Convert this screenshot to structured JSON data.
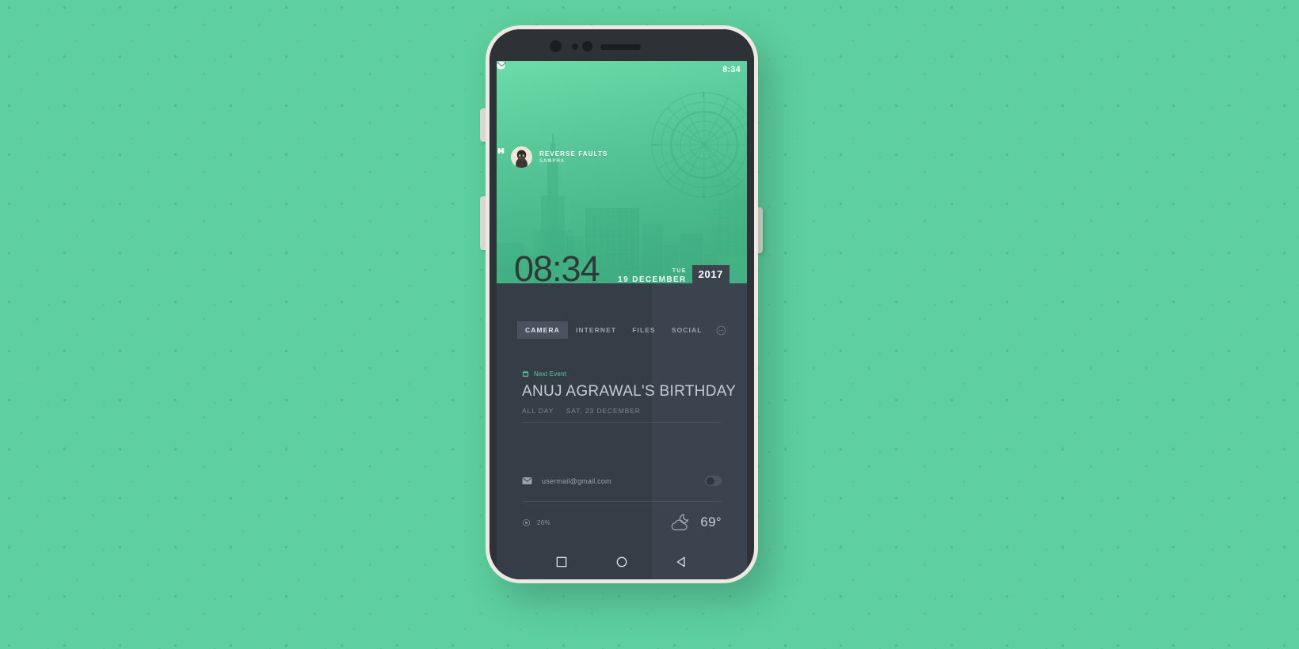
{
  "wallpaper_theme": {
    "accent_green": "#5ecf9e",
    "panel_dark": "#3b434e",
    "text_muted": "#9aa3ae"
  },
  "statusbar": {
    "left_icons": [
      "music-note-icon",
      "photo-icon",
      "play-store-icon"
    ],
    "right_icons": [
      "wifi-icon",
      "signal-icon",
      "battery-circle-icon"
    ],
    "time": "8:34",
    "expand_icon": "chevron-down-icon"
  },
  "music_widget": {
    "track_title": "REVERSE FAULTS",
    "artist": "SAMPHA",
    "album_art_icon": "album-art-avatar",
    "controls": [
      {
        "name": "previous-track-button",
        "icon": "skip-previous-icon"
      },
      {
        "name": "next-track-button",
        "icon": "skip-next-icon"
      },
      {
        "name": "pause-button",
        "icon": "pause-icon"
      }
    ]
  },
  "clock": {
    "time": "08:34",
    "day_of_week": "TUE",
    "day_month": "19 DECEMBER",
    "year": "2017"
  },
  "tabs": {
    "items": [
      {
        "label": "CAMERA",
        "active": true
      },
      {
        "label": "INTERNET",
        "active": false
      },
      {
        "label": "FILES",
        "active": false
      },
      {
        "label": "SOCIAL",
        "active": false
      }
    ],
    "more_icon": "overflow-circle-icon"
  },
  "event": {
    "icon": "calendar-icon",
    "label": "Next Event",
    "title": "ANUJ AGRAWAL'S BIRTHDAY",
    "all_day": "ALL DAY",
    "date": "SAT, 23 DECEMBER"
  },
  "mail": {
    "icon": "envelope-icon",
    "address": "usermail@gmail.com",
    "toggle_state": "off"
  },
  "weather": {
    "battery_icon": "battery-circle-icon",
    "battery_percent": "26%",
    "condition_icon": "cloudy-night-icon",
    "temperature": "69°"
  },
  "dock": {
    "items": [
      {
        "name": "app-drawer-button",
        "icon": "app-grid-icon"
      },
      {
        "name": "telegram-button",
        "icon": "paper-plane-icon"
      },
      {
        "name": "whatsapp-button",
        "icon": "whatsapp-icon"
      }
    ],
    "more_icon": "overflow-vertical-icon",
    "pull_icon": "chevron-up-icon"
  },
  "navbar": {
    "items": [
      {
        "name": "recents-button",
        "icon": "square-icon"
      },
      {
        "name": "home-button",
        "icon": "circle-icon"
      },
      {
        "name": "back-button",
        "icon": "triangle-back-icon"
      }
    ]
  }
}
